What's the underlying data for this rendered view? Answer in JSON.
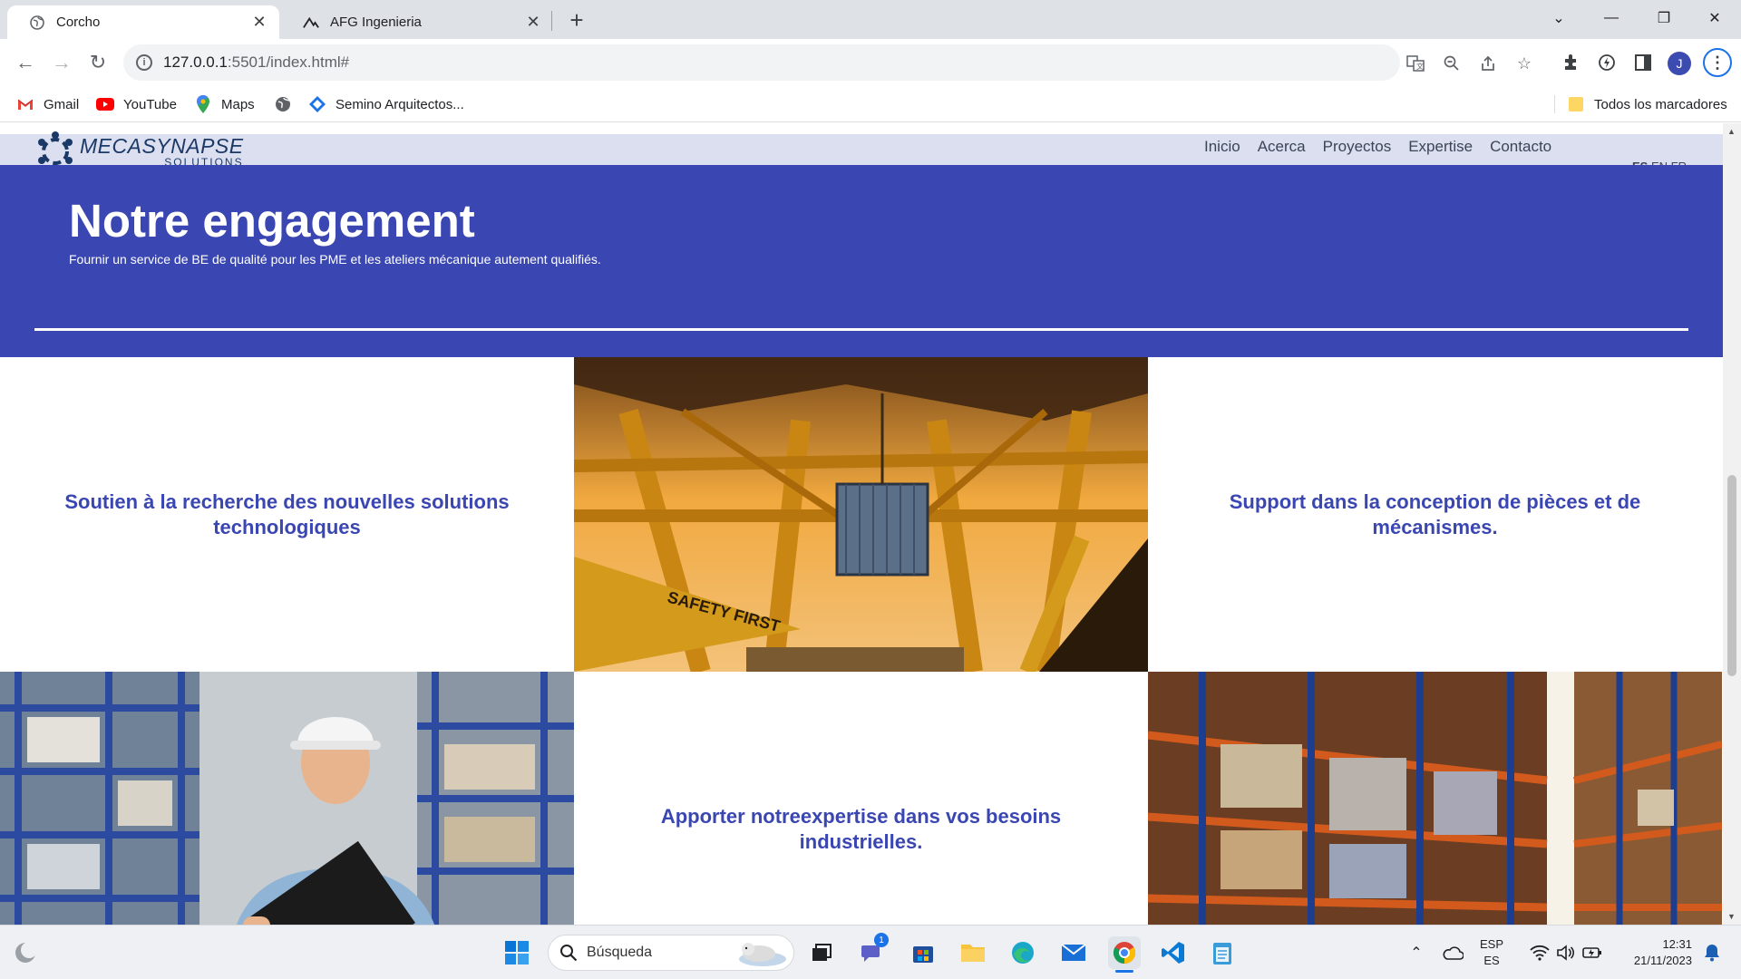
{
  "browser": {
    "tabs": [
      {
        "title": "Corcho",
        "favicon": "globe-icon",
        "active": true
      },
      {
        "title": "AFG Ingenieria",
        "favicon": "afg-logo-icon",
        "active": false
      }
    ],
    "url_host": "127.0.0.1",
    "url_rest": ":5501/index.html#",
    "bookmarks": [
      {
        "label": "Gmail",
        "icon": "gmail-icon"
      },
      {
        "label": "YouTube",
        "icon": "youtube-icon"
      },
      {
        "label": "Maps",
        "icon": "maps-icon"
      },
      {
        "label": "",
        "icon": "globe-icon"
      },
      {
        "label": "Semino Arquitectos...",
        "icon": "diamond-icon"
      }
    ],
    "all_bookmarks": "Todos los marcadores",
    "profile_initial": "J"
  },
  "site": {
    "brand": "MECASYNAPSE",
    "brand_sub": "SOLUTIONS",
    "nav": [
      "Inicio",
      "Acerca",
      "Proyectos",
      "Expertise",
      "Contacto"
    ],
    "langs": {
      "active": "ES",
      "others": "EN FR"
    },
    "hero": {
      "title": "Notre engagement",
      "subtitle": "Fournir un service de BE de qualité pour les PME et les ateliers mécanique autement qualifiés."
    },
    "cards": {
      "c1": "Soutien à la recherche des nouvelles solutions technologiques",
      "c2": "Support dans la conception de pièces et de mécanismes.",
      "c3": "Apporter notreexpertise dans vos besoins industrielles."
    },
    "photo_text": {
      "crane_sign": "SAFETY FIRST"
    },
    "colors": {
      "hero_bg": "#3a46b1",
      "nav_bg": "#dcdff0",
      "card_text": "#3a46b1"
    }
  },
  "taskbar": {
    "search_label": "Búsqueda",
    "chat_badge": "1",
    "lang_top": "ESP",
    "lang_bottom": "ES",
    "time": "12:31",
    "date": "21/11/2023"
  }
}
